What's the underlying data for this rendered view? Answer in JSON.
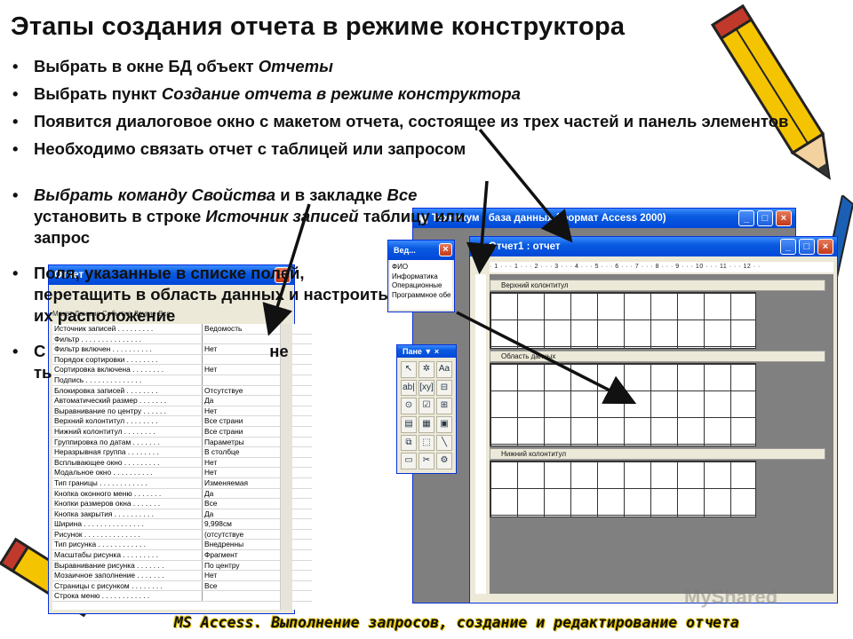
{
  "slide": {
    "title": "Этапы создания отчета в режиме конструктора",
    "bullets": [
      {
        "prefix": "Выбрать в окне БД объект ",
        "italic": "Отчеты",
        "suffix": ""
      },
      {
        "prefix": "Выбрать пункт ",
        "italic": "Создание отчета в режиме конструктора",
        "suffix": ""
      },
      {
        "prefix": "Появится диалоговое окно с макетом отчета, состоящее из трех частей и панель элементов",
        "italic": "",
        "suffix": ""
      },
      {
        "prefix": "Необходимо связать отчет с таблицей или запросом",
        "italic": "",
        "suffix": ""
      }
    ],
    "bullet5": {
      "i1": "Выбрать команду Свойства",
      "t1": " и в закладке ",
      "i2": "Все",
      "t2": " установить в строке ",
      "i3": "Источник записей",
      "t3": " таблицу или запрос"
    },
    "bullet6": "Поля, указанные в списке полей, перетащить в область данных и настроить их расположение",
    "bullet7": "С                                                 не                                                ть",
    "footer": "MS Access. Выполнение запросов, создание и редактирование отчета",
    "watermark": "MyShared"
  },
  "db_window": {
    "title": "Техникум : база данных (формат Access 2000)"
  },
  "fields_window": {
    "title": "Вед...",
    "items": [
      "ФИО",
      "Информатика",
      "Операционные",
      "Программное обе"
    ]
  },
  "toolbox": {
    "title": "Пане ▼ ×",
    "tools": [
      "↖",
      "✲",
      "Aa",
      "ab|",
      "[xy]",
      "⊟",
      "⊙",
      "☑",
      "⊞",
      "▤",
      "▦",
      "▣",
      "⧉",
      "⬚",
      "╲",
      "▭",
      "✂",
      "⚙"
    ]
  },
  "report_window": {
    "title": "Отчет1 : отчет",
    "ruler": "· 1 · · · 1 · · · 2 · · · 3 · · · 4 · · · 5 · · · 6 · · · 7 · · · 8 · · · 9 · · · 10 · · · 11 · · · 12 · ·",
    "sections": [
      "Верхний колонтитул",
      "Область данных",
      "Нижний колонтитул"
    ]
  },
  "properties_window": {
    "title": "Отчет",
    "tabs": "Макет   Данные   События   Другие   Все",
    "rows": [
      {
        "name": "Источник записей . . . . . . . . .",
        "value": "Ведомость"
      },
      {
        "name": "Фильтр . . . . . . . . . . . . . . .",
        "value": ""
      },
      {
        "name": "Фильтр включен . . . . . . . . . .",
        "value": "Нет"
      },
      {
        "name": "Порядок сортировки . . . . . . . .",
        "value": ""
      },
      {
        "name": "Сортировка включена . . . . . . . .",
        "value": "Нет"
      },
      {
        "name": "Подпись . . . . . . . . . . . . . .",
        "value": ""
      },
      {
        "name": "Блокировка записей . . . . . . . .",
        "value": "Отсутствуе"
      },
      {
        "name": "Автоматический размер . . . . . . .",
        "value": "Да"
      },
      {
        "name": "Выравнивание по центру . . . . . .",
        "value": "Нет"
      },
      {
        "name": "Верхний колонтитул . . . . . . . .",
        "value": "Все страни"
      },
      {
        "name": "Нижний колонтитул . . . . . . . .",
        "value": "Все страни"
      },
      {
        "name": "Группировка по датам . . . . . . .",
        "value": "Параметры"
      },
      {
        "name": "Неразрывная группа . . . . . . . .",
        "value": "В столбце"
      },
      {
        "name": "Всплывающее окно . . . . . . . . .",
        "value": "Нет"
      },
      {
        "name": "Модальное окно . . . . . . . . . .",
        "value": "Нет"
      },
      {
        "name": "Тип границы . . . . . . . . . . . .",
        "value": "Изменяемая"
      },
      {
        "name": "Кнопка оконного меню . . . . . . .",
        "value": "Да"
      },
      {
        "name": "Кнопки размеров окна . . . . . . .",
        "value": "Все"
      },
      {
        "name": "Кнопка закрытия . . . . . . . . . .",
        "value": "Да"
      },
      {
        "name": "Ширина . . . . . . . . . . . . . . .",
        "value": "9,998см"
      },
      {
        "name": "Рисунок . . . . . . . . . . . . . .",
        "value": "(отсутствуе"
      },
      {
        "name": "Тип рисунка . . . . . . . . . . . .",
        "value": "Внедренны"
      },
      {
        "name": "Масштабы рисунка . . . . . . . . .",
        "value": "Фрагмент"
      },
      {
        "name": "Выравнивание рисунка . . . . . . .",
        "value": "По центру"
      },
      {
        "name": "Мозаичное заполнение . . . . . . .",
        "value": "Нет"
      },
      {
        "name": "Страницы с рисунком . . . . . . . .",
        "value": "Все"
      },
      {
        "name": "Строка меню . . . . . . . . . . . .",
        "value": ""
      }
    ]
  }
}
